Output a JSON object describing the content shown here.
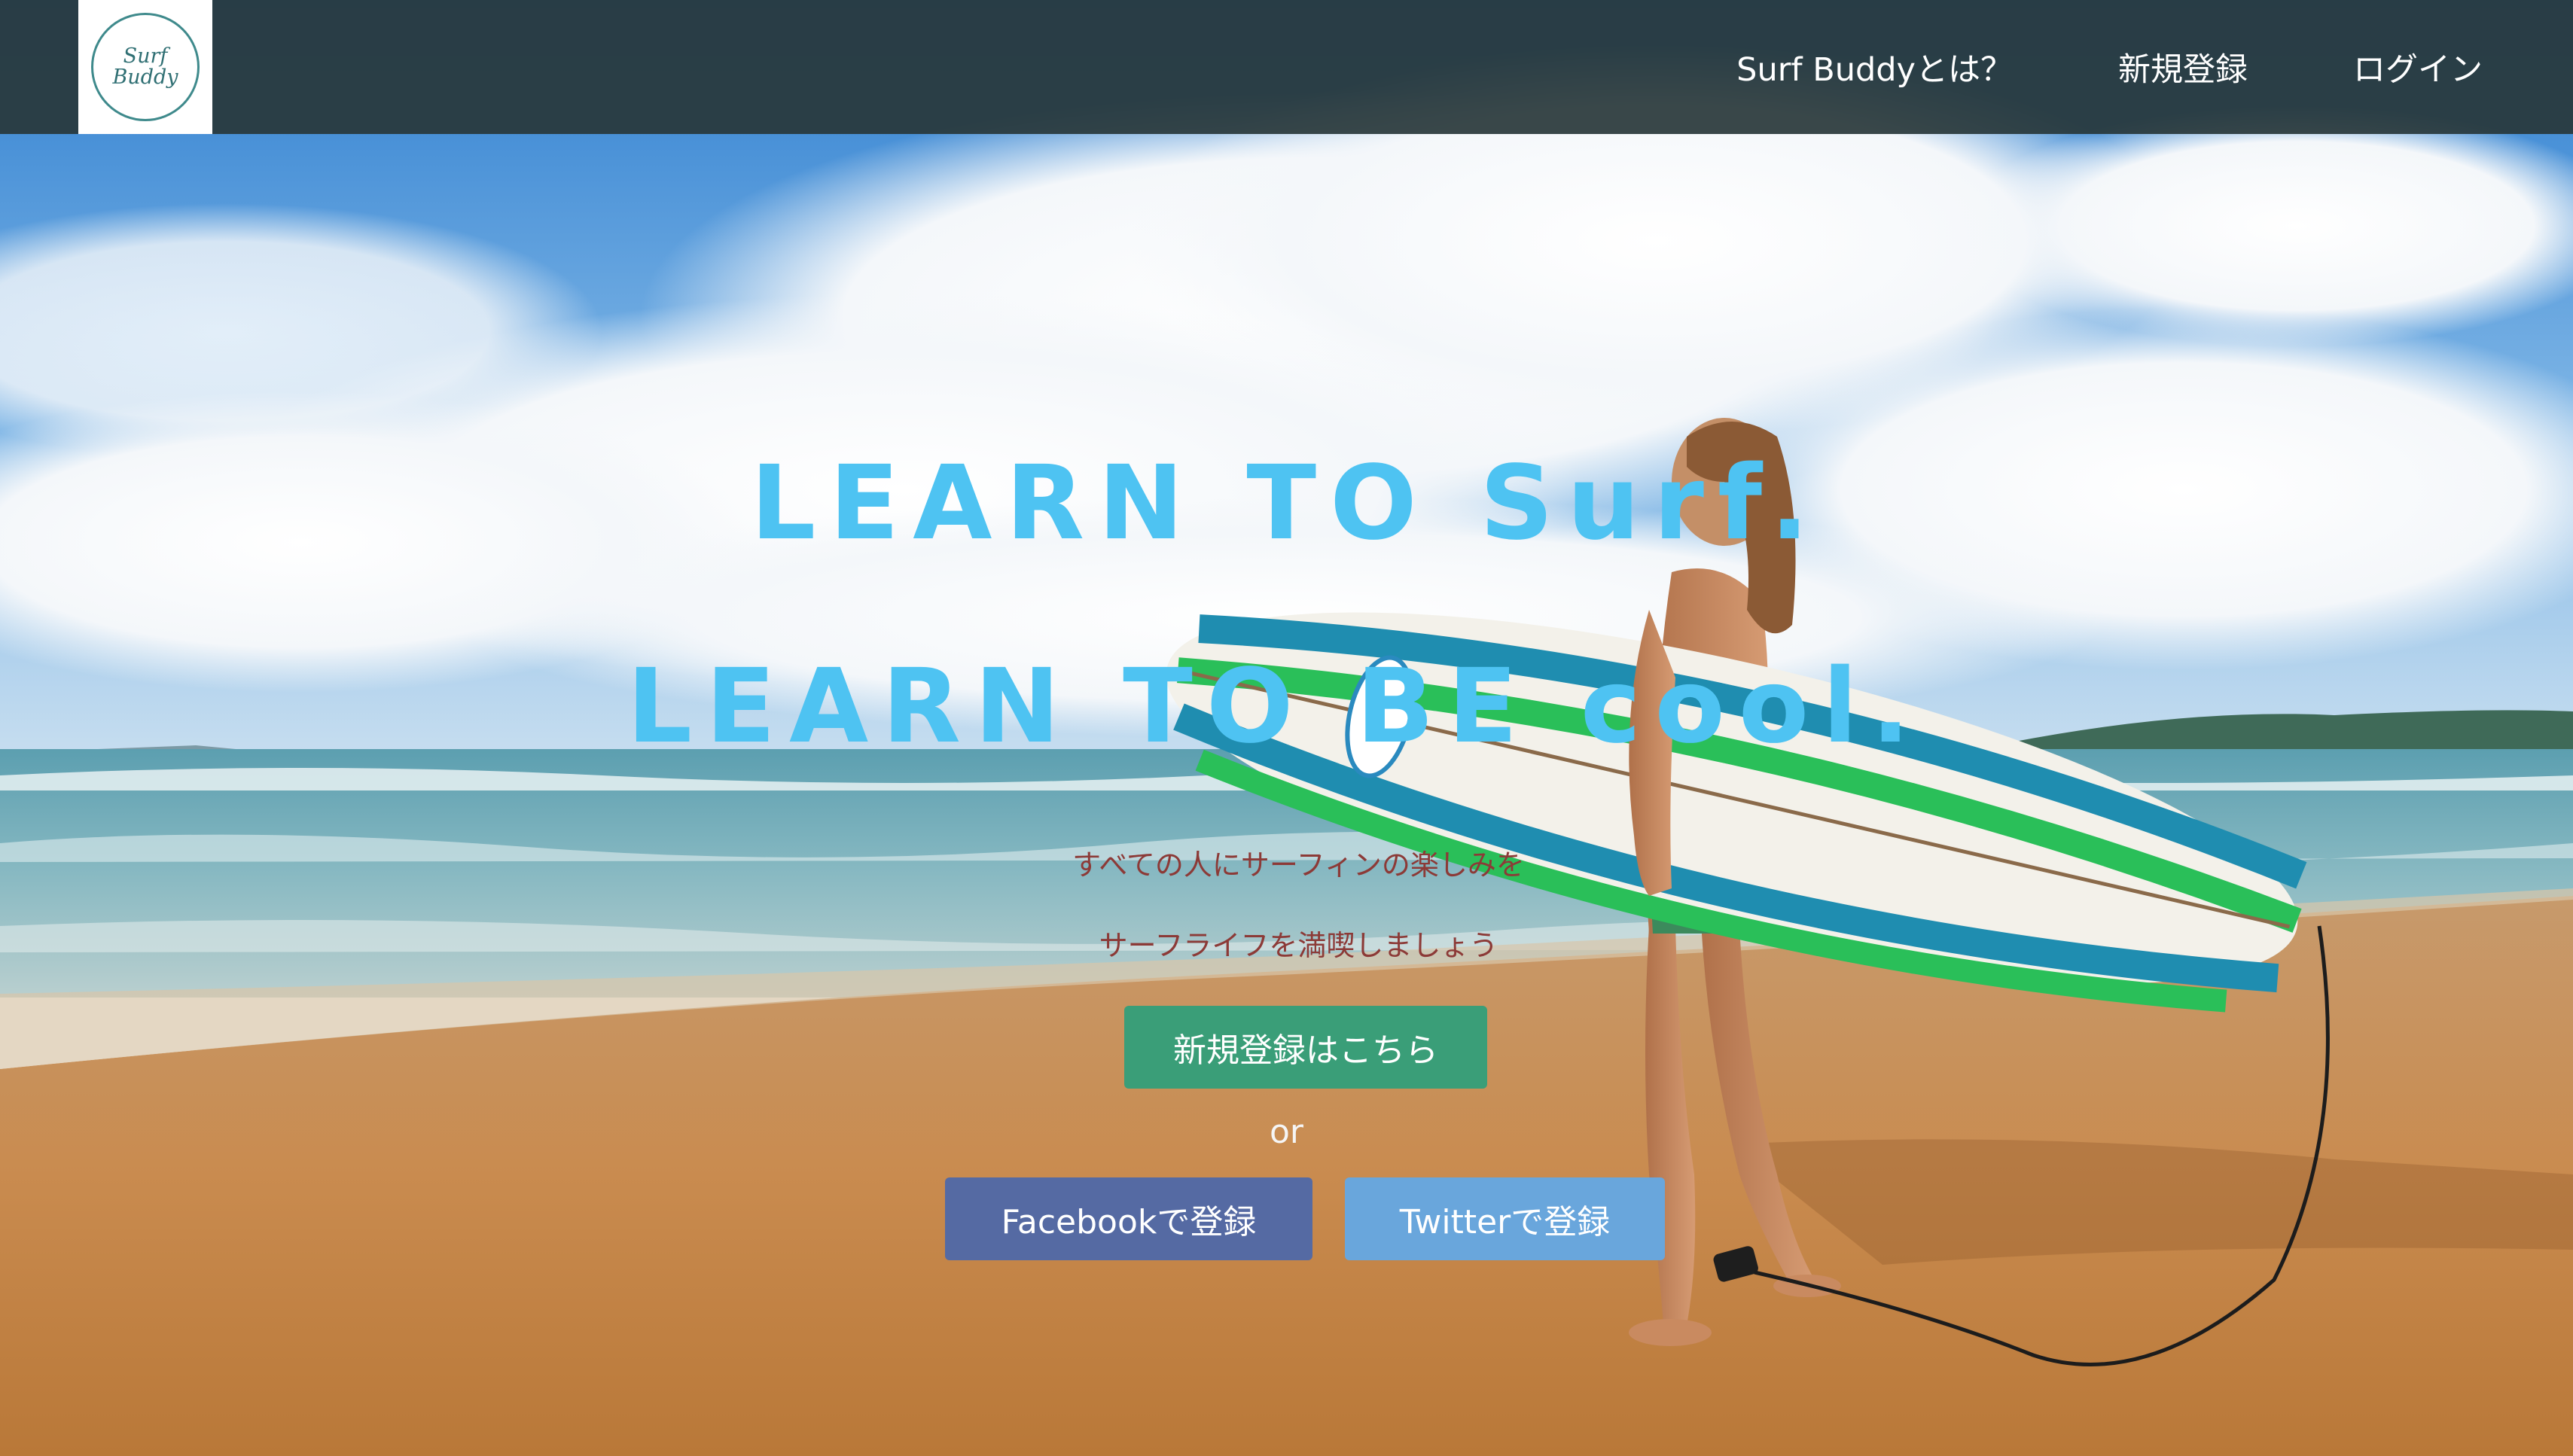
{
  "logo": {
    "line1": "Surf",
    "line2": "Buddy"
  },
  "nav": {
    "items": [
      {
        "label": "Surf Buddyとは？"
      },
      {
        "label": "新規登録"
      },
      {
        "label": "ログイン"
      }
    ]
  },
  "hero": {
    "headline_line1": "LEARN TO Surf.",
    "headline_line2": "LEARN TO BE cool.",
    "tagline_line1": "すべての人にサーフィンの楽しみを",
    "tagline_line2": "サーフライフを満喫しましょう",
    "signup_button": "新規登録はこちら",
    "or_text": "or",
    "facebook_button": "Facebookで登録",
    "twitter_button": "Twitterで登録"
  },
  "colors": {
    "header_bg": "#28373a",
    "headline": "#4ec3f2",
    "tagline": "#8c3a37",
    "signup_button": "#3a9e78",
    "facebook_button": "#556aa3",
    "twitter_button": "#69a6dc"
  }
}
